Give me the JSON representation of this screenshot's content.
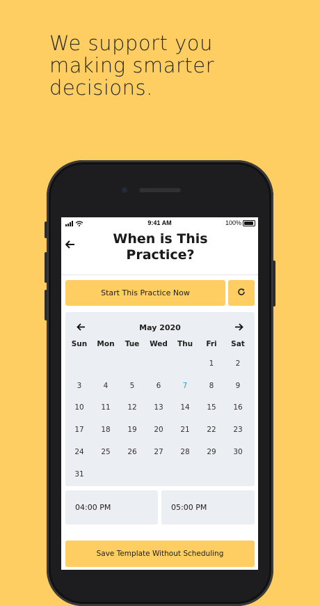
{
  "headline": {
    "line1": "We support you",
    "line2": "making smarter",
    "line3": "decisions."
  },
  "statusbar": {
    "time": "9:41 AM",
    "battery": "100%"
  },
  "header": {
    "title_line1": "When is This",
    "title_line2": "Practice?"
  },
  "actions": {
    "start_label": "Start This Practice Now"
  },
  "calendar": {
    "month": "May 2020",
    "weekdays": [
      "Sun",
      "Mon",
      "Tue",
      "Wed",
      "Thu",
      "Fri",
      "Sat"
    ],
    "weeks": [
      [
        "",
        "",
        "",
        "",
        "",
        "1",
        "2"
      ],
      [
        "3",
        "4",
        "5",
        "6",
        "7",
        "8",
        "9"
      ],
      [
        "10",
        "11",
        "12",
        "13",
        "14",
        "15",
        "16"
      ],
      [
        "17",
        "18",
        "19",
        "20",
        "21",
        "22",
        "23"
      ],
      [
        "24",
        "25",
        "26",
        "27",
        "28",
        "29",
        "30"
      ],
      [
        "31",
        "",
        "",
        "",
        "",
        "",
        ""
      ]
    ],
    "highlighted_day": "7",
    "highlight_color": "#2B9BD8"
  },
  "times": {
    "start": "04:00 PM",
    "end": "05:00 PM"
  },
  "footer": {
    "save_label": "Save Template Without Scheduling"
  },
  "colors": {
    "background": "#FECE63",
    "accent": "#FECE63",
    "panel": "#EBEEF2"
  }
}
